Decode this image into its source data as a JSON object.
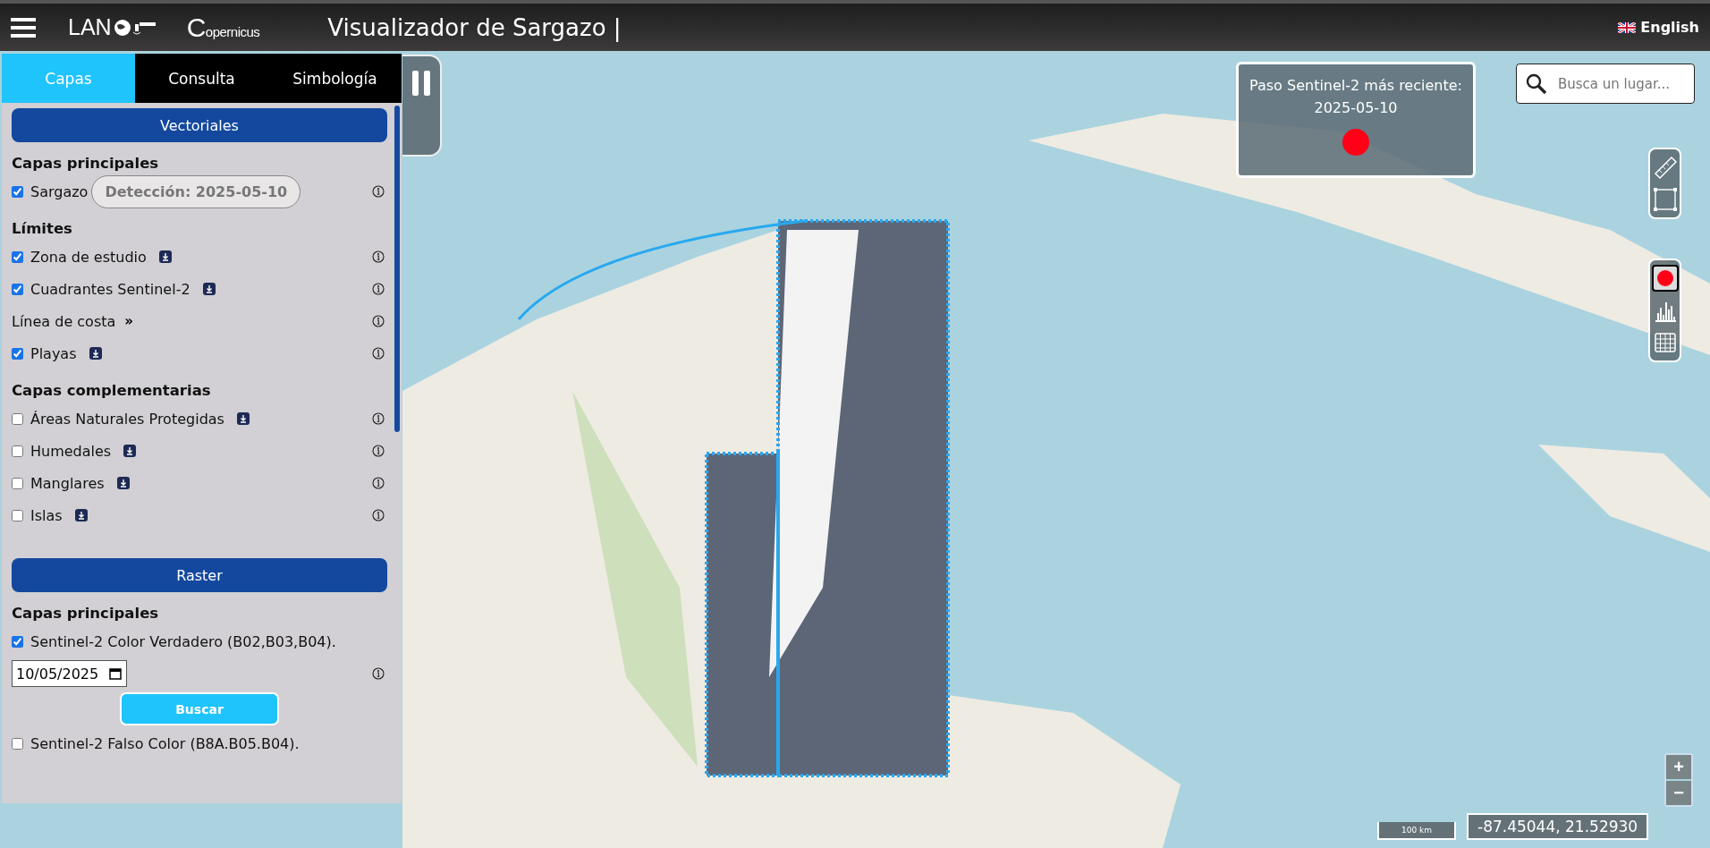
{
  "header": {
    "brand": "LAN",
    "partner": "Copernicus",
    "title": "Visualizador de Sargazo |",
    "language": "English"
  },
  "tabs": [
    {
      "label": "Capas",
      "selected": true
    },
    {
      "label": "Consulta",
      "selected": false
    },
    {
      "label": "Simbología",
      "selected": false
    }
  ],
  "vector": {
    "button": "Vectoriales",
    "groups": [
      {
        "heading": "Capas principales",
        "rows": [
          {
            "kind": "badge",
            "label": "Sargazo",
            "checked": true,
            "badge": "Detección: 2025-05-10"
          }
        ]
      },
      {
        "heading": "Límites",
        "rows": [
          {
            "kind": "check",
            "label": "Zona de estudio",
            "checked": true
          },
          {
            "kind": "check",
            "label": "Cuadrantes Sentinel-2",
            "checked": true
          },
          {
            "kind": "expand",
            "label": "Línea de costa",
            "arrow": "»"
          },
          {
            "kind": "check",
            "label": "Playas",
            "checked": true
          }
        ]
      },
      {
        "heading": "Capas complementarias",
        "rows": [
          {
            "kind": "check",
            "label": "Áreas Naturales Protegidas",
            "checked": false
          },
          {
            "kind": "check",
            "label": "Humedales",
            "checked": false
          },
          {
            "kind": "check",
            "label": "Manglares",
            "checked": false
          },
          {
            "kind": "check",
            "label": "Islas",
            "checked": false
          }
        ]
      }
    ]
  },
  "raster": {
    "button": "Raster",
    "heading": "Capas principales",
    "true_color": {
      "label": "Sentinel-2 Color Verdadero (B02,B03,B04).",
      "checked": true
    },
    "date": "10/05/2025",
    "search_button": "Buscar",
    "false_color": {
      "label": "Sentinel-2 Falso Color (B8A.B05.B04).",
      "checked": false
    }
  },
  "latest_pass": {
    "title": "Paso Sentinel-2 más reciente:",
    "date": "2025-05-10"
  },
  "search": {
    "placeholder": "Busca un lugar..."
  },
  "zoom": [
    "+",
    "−"
  ],
  "scale": "100 km",
  "coordinates": "-87.45044, 21.52930"
}
